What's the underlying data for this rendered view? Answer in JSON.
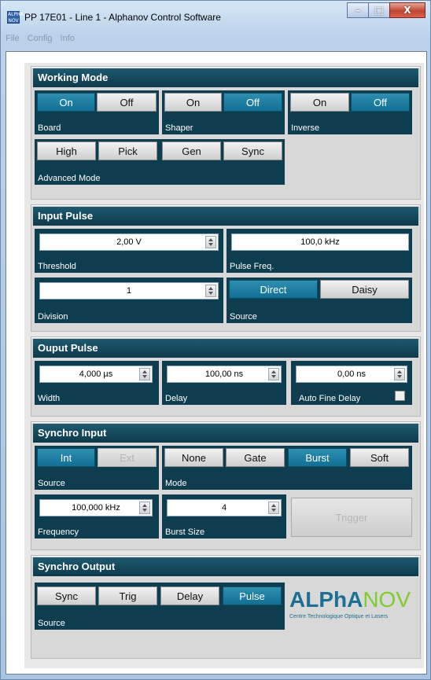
{
  "window": {
    "icon_text": "ALPHA NOV",
    "title": "PP 17E01 - Line 1 - Alphanov Control Software",
    "minimize": "–",
    "maximize": "□",
    "close": "X"
  },
  "menu": [
    "File",
    "Config",
    "Info"
  ],
  "working_mode": {
    "title": "Working Mode",
    "board": {
      "label": "Board",
      "on": "On",
      "off": "Off",
      "active": "on"
    },
    "shaper": {
      "label": "Shaper",
      "on": "On",
      "off": "Off",
      "active": "off"
    },
    "inverse": {
      "label": "Inverse",
      "on": "On",
      "off": "Off",
      "active": "off"
    },
    "advanced": {
      "label": "Advanced Mode",
      "buttons": [
        "High",
        "Pick",
        "Gen",
        "Sync"
      ]
    }
  },
  "input_pulse": {
    "title": "Input Pulse",
    "threshold": {
      "label": "Threshold",
      "value": "2,00 V"
    },
    "pulse_freq": {
      "label": "Pulse Freq.",
      "value": "100,0 kHz"
    },
    "division": {
      "label": "Division",
      "value": "1"
    },
    "source": {
      "label": "Source",
      "direct": "Direct",
      "daisy": "Daisy",
      "active": "direct"
    }
  },
  "output_pulse": {
    "title": "Ouput Pulse",
    "width": {
      "label": "Width",
      "value": "4,000 µs"
    },
    "delay": {
      "label": "Delay",
      "value": "100,00 ns"
    },
    "fine_delay": {
      "value": "0,00 ns",
      "auto_label": "Auto Fine Delay",
      "checked": false
    }
  },
  "synchro_input": {
    "title": "Synchro Input",
    "source": {
      "label": "Source",
      "int": "Int",
      "ext": "Ext",
      "active": "int"
    },
    "mode": {
      "label": "Mode",
      "buttons": [
        "None",
        "Gate",
        "Burst",
        "Soft"
      ],
      "active": "Burst"
    },
    "frequency": {
      "label": "Frequency",
      "value": "100,000 kHz"
    },
    "burst_size": {
      "label": "Burst Size",
      "value": "4"
    },
    "trigger": "Trigger"
  },
  "synchro_output": {
    "title": "Synchro Output",
    "source": {
      "label": "Source",
      "buttons": [
        "Sync",
        "Trig",
        "Delay",
        "Pulse"
      ],
      "active": "Pulse"
    },
    "logo": {
      "alpha": "ALPhA",
      "nov": "NOV",
      "tagline": "Centre Technologique Optique et Lasers"
    }
  },
  "colors": {
    "accent": "#116f95",
    "panel": "#0f3d50",
    "logo_blue": "#1d6f94",
    "logo_green": "#7fcc2e"
  }
}
